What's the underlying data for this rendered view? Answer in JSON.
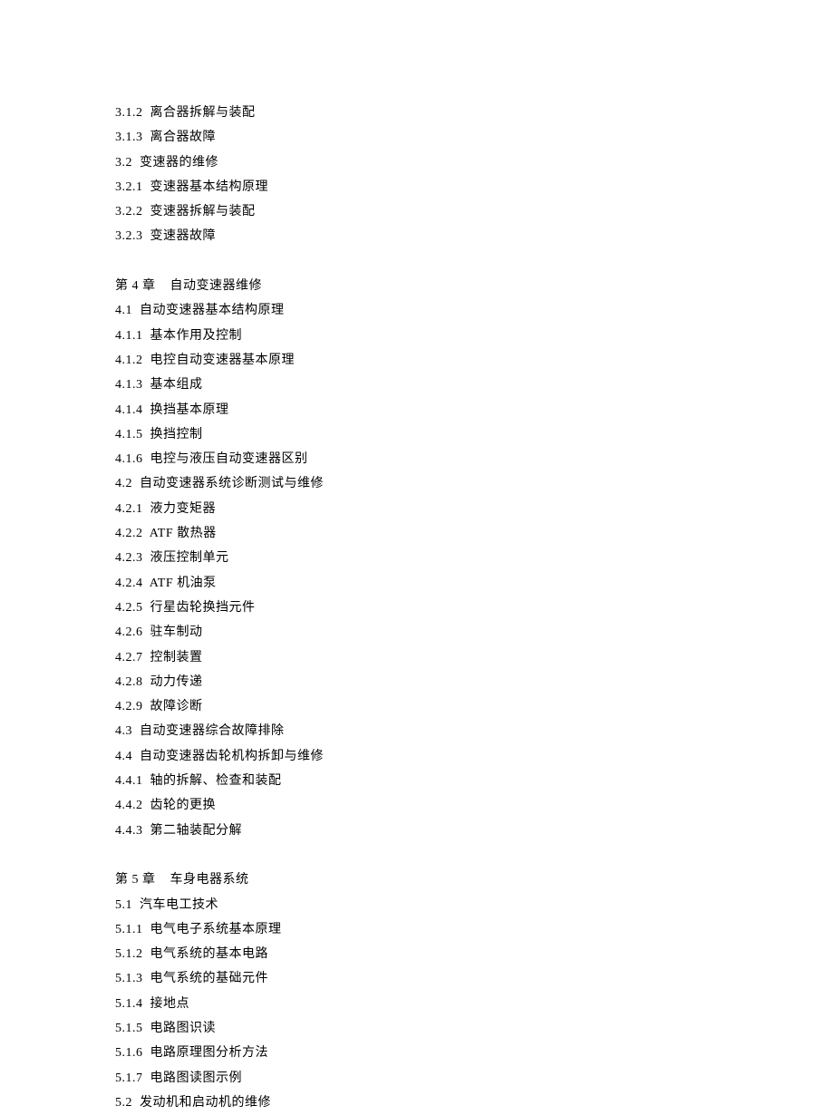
{
  "lines": [
    {
      "num": "3.1.2",
      "title": "离合器拆解与装配"
    },
    {
      "num": "3.1.3",
      "title": "离合器故障"
    },
    {
      "num": "3.2",
      "title": "变速器的维修"
    },
    {
      "num": "3.2.1",
      "title": "变速器基本结构原理"
    },
    {
      "num": "3.2.2",
      "title": "变速器拆解与装配"
    },
    {
      "num": "3.2.3",
      "title": "变速器故障"
    },
    {
      "blank": true
    },
    {
      "chapter": "第 4 章",
      "title": "自动变速器维修"
    },
    {
      "num": "4.1",
      "title": "自动变速器基本结构原理"
    },
    {
      "num": "4.1.1",
      "title": "基本作用及控制"
    },
    {
      "num": "4.1.2",
      "title": "电控自动变速器基本原理"
    },
    {
      "num": "4.1.3",
      "title": "基本组成"
    },
    {
      "num": "4.1.4",
      "title": "换挡基本原理"
    },
    {
      "num": "4.1.5",
      "title": "换挡控制"
    },
    {
      "num": "4.1.6",
      "title": "电控与液压自动变速器区别"
    },
    {
      "num": "4.2",
      "title": "自动变速器系统诊断测试与维修"
    },
    {
      "num": "4.2.1",
      "title": "液力变矩器"
    },
    {
      "num": "4.2.2",
      "title": "ATF 散热器"
    },
    {
      "num": "4.2.3",
      "title": "液压控制单元"
    },
    {
      "num": "4.2.4",
      "title": "ATF 机油泵"
    },
    {
      "num": "4.2.5",
      "title": "行星齿轮换挡元件"
    },
    {
      "num": "4.2.6",
      "title": "驻车制动"
    },
    {
      "num": "4.2.7",
      "title": "控制装置"
    },
    {
      "num": "4.2.8",
      "title": "动力传递"
    },
    {
      "num": "4.2.9",
      "title": "故障诊断"
    },
    {
      "num": "4.3",
      "title": "自动变速器综合故障排除"
    },
    {
      "num": "4.4",
      "title": "自动变速器齿轮机构拆卸与维修"
    },
    {
      "num": "4.4.1",
      "title": "轴的拆解、检查和装配"
    },
    {
      "num": "4.4.2",
      "title": "齿轮的更换"
    },
    {
      "num": "4.4.3",
      "title": "第二轴装配分解"
    },
    {
      "blank": true
    },
    {
      "chapter": "第 5 章",
      "title": "车身电器系统"
    },
    {
      "num": "5.1",
      "title": "汽车电工技术"
    },
    {
      "num": "5.1.1",
      "title": "电气电子系统基本原理"
    },
    {
      "num": "5.1.2",
      "title": "电气系统的基本电路"
    },
    {
      "num": "5.1.3",
      "title": "电气系统的基础元件"
    },
    {
      "num": "5.1.4",
      "title": "接地点"
    },
    {
      "num": "5.1.5",
      "title": "电路图识读"
    },
    {
      "num": "5.1.6",
      "title": "电路原理图分析方法"
    },
    {
      "num": "5.1.7",
      "title": "电路图读图示例"
    },
    {
      "num": "5.2",
      "title": "发动机和启动机的维修"
    }
  ]
}
